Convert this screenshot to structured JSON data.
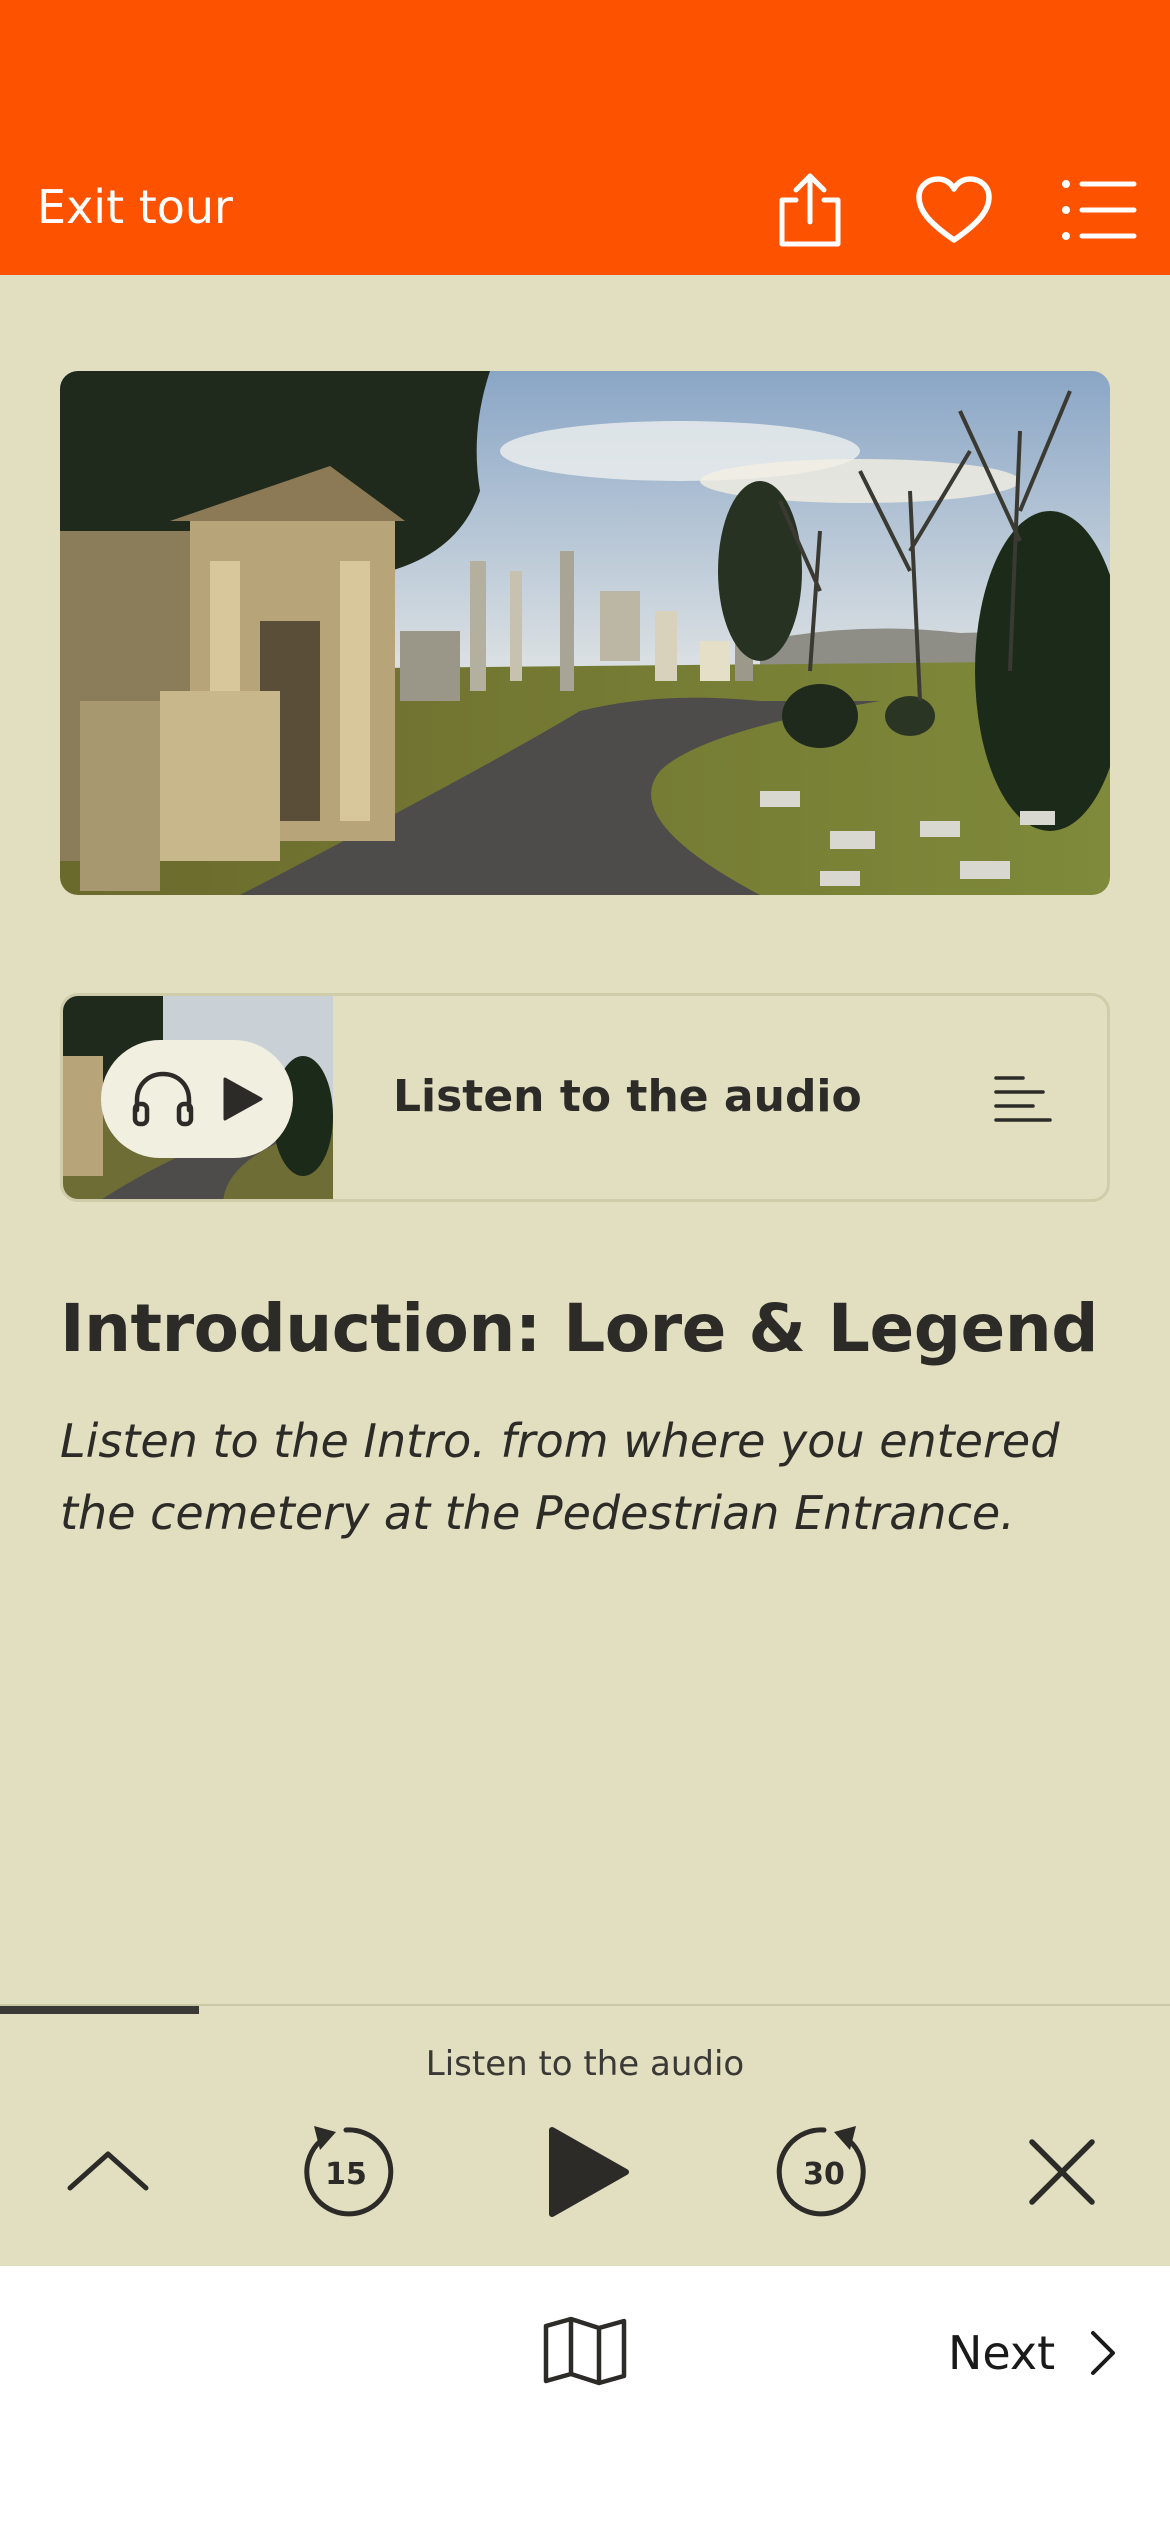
{
  "header": {
    "exit_label": "Exit tour",
    "bg_color": "#fd5200",
    "icons": [
      "share-icon",
      "heart-icon",
      "list-icon"
    ]
  },
  "audio_card": {
    "label": "Listen to the audio",
    "icons": [
      "headphones-icon",
      "play-icon",
      "transcript-icon"
    ]
  },
  "intro": {
    "title": "Introduction: Lore & Legend",
    "description": "Listen to the Intro. from where you entered the cemetery at the Pedestrian Entrance."
  },
  "player": {
    "title": "Listen to the audio",
    "rewind_seconds": "15",
    "forward_seconds": "30",
    "progress_fraction": 0.17
  },
  "bottom_bar": {
    "next_label": "Next"
  },
  "colors": {
    "accent": "#fd5200",
    "background": "#e1dfc0",
    "text": "#2c2b28"
  }
}
